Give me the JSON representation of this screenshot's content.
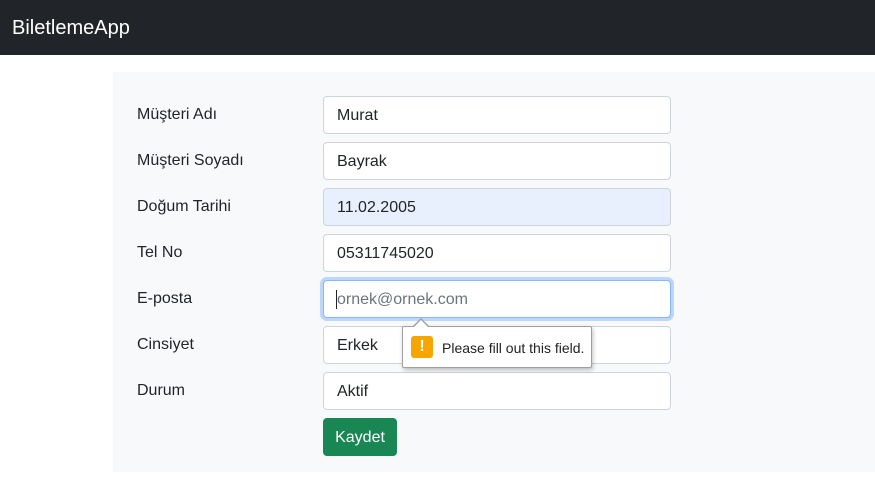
{
  "app": {
    "brand": "BiletlemeApp"
  },
  "form": {
    "fields": [
      {
        "label": "Müşteri Adı",
        "value": "Murat",
        "placeholder": ""
      },
      {
        "label": "Müşteri Soyadı",
        "value": "Bayrak",
        "placeholder": ""
      },
      {
        "label": "Doğum Tarihi",
        "value": "11.02.2005",
        "placeholder": ""
      },
      {
        "label": "Tel No",
        "value": "05311745020",
        "placeholder": ""
      },
      {
        "label": "E-posta",
        "value": "",
        "placeholder": "ornek@ornek.com"
      },
      {
        "label": "Cinsiyet",
        "value": "Erkek",
        "placeholder": ""
      },
      {
        "label": "Durum",
        "value": "Aktif",
        "placeholder": ""
      }
    ],
    "submit_label": "Kaydet"
  },
  "validation": {
    "message": "Please fill out this field.",
    "icon": "warning-icon"
  },
  "colors": {
    "navbar_bg": "#212529",
    "submit_bg": "#198754",
    "autofill_bg": "#e8f0fe",
    "focus_border": "#86b7fe",
    "warning": "#f7a600"
  }
}
